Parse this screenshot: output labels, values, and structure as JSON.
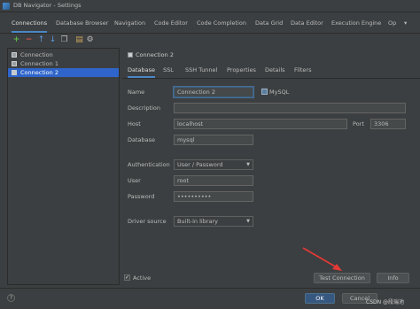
{
  "window": {
    "title": "DB Navigator - Settings"
  },
  "tabs": [
    {
      "label": "Connections",
      "active": true
    },
    {
      "label": "Database Browser"
    },
    {
      "label": "Navigation"
    },
    {
      "label": "Code Editor"
    },
    {
      "label": "Code Completion"
    },
    {
      "label": "Data Grid"
    },
    {
      "label": "Data Editor"
    },
    {
      "label": "Execution Engine"
    },
    {
      "label": "Op"
    }
  ],
  "toolbar": {
    "icons": [
      "add-icon",
      "remove-icon",
      "move-up-icon",
      "move-down-icon",
      "copy-icon",
      "paste-icon",
      "settings-icon"
    ]
  },
  "connections": [
    {
      "label": "Connection",
      "selected": false
    },
    {
      "label": "Connection 1",
      "selected": false
    },
    {
      "label": "Connection 2",
      "selected": true
    }
  ],
  "detail": {
    "header": "Connection 2",
    "subtabs": [
      {
        "label": "Database",
        "active": true
      },
      {
        "label": "SSL"
      },
      {
        "label": "SSH Tunnel"
      },
      {
        "label": "Properties"
      },
      {
        "label": "Details"
      },
      {
        "label": "Filters"
      }
    ],
    "labels": {
      "name": "Name",
      "description": "Description",
      "host": "Host",
      "port": "Port",
      "database": "Database",
      "authentication": "Authentication",
      "user": "User",
      "password": "Password",
      "driver_source": "Driver source"
    },
    "values": {
      "name": "Connection 2",
      "db_type": "MySQL",
      "description": "",
      "host": "localhost",
      "port": "3306",
      "database": "mysql",
      "authentication": "User / Password",
      "user": "root",
      "password": "••••••••••",
      "driver_source": "Built-in library"
    },
    "active_label": "Active",
    "active_checked": true,
    "test_connection_label": "Test Connection",
    "info_label": "Info"
  },
  "footer": {
    "help_label": "?",
    "ok_label": "OK",
    "cancel_label": "Cancel"
  },
  "watermark": "CSDN @段瑞池",
  "annotation": {
    "arrow_color": "#e53935",
    "points_to": "test-connection-button"
  },
  "colors": {
    "background": "#3c3f41",
    "selection": "#2f65ca",
    "accent_underline": "#4a88c7",
    "primary_button": "#365880"
  }
}
